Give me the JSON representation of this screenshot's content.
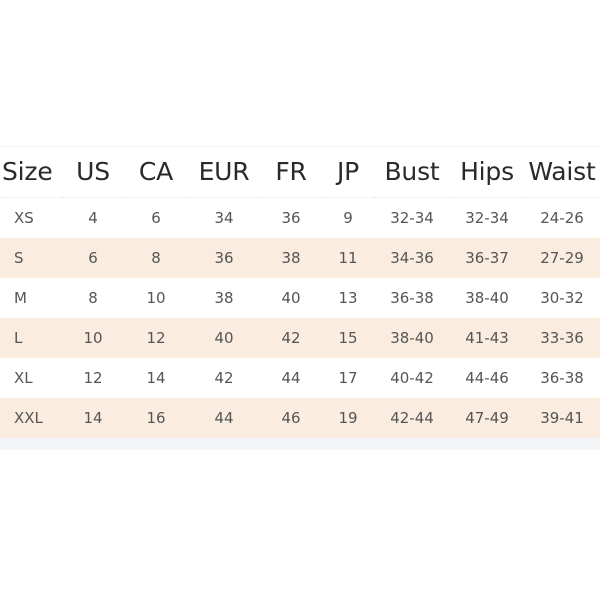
{
  "chart_data": {
    "type": "table",
    "title": "",
    "columns": [
      "Size",
      "US",
      "CA",
      "EUR",
      "FR",
      "JP",
      "Bust",
      "Hips",
      "Waist"
    ],
    "rows": [
      [
        "XS",
        "4",
        "6",
        "34",
        "36",
        "9",
        "32-34",
        "32-34",
        "24-26"
      ],
      [
        "S",
        "6",
        "8",
        "36",
        "38",
        "11",
        "34-36",
        "36-37",
        "27-29"
      ],
      [
        "M",
        "8",
        "10",
        "38",
        "40",
        "13",
        "36-38",
        "38-40",
        "30-32"
      ],
      [
        "L",
        "10",
        "12",
        "40",
        "42",
        "15",
        "38-40",
        "41-43",
        "33-36"
      ],
      [
        "XL",
        "12",
        "14",
        "42",
        "44",
        "17",
        "40-42",
        "44-46",
        "36-38"
      ],
      [
        "XXL",
        "14",
        "16",
        "44",
        "46",
        "19",
        "42-44",
        "47-49",
        "39-41"
      ]
    ]
  },
  "colors": {
    "page_background": "#ffffff",
    "row_alt_background": "#faede0",
    "row_base_background": "#ffffff",
    "header_text": "#2a2a2a",
    "body_text": "#555555",
    "header_rule": "#e6e7e9",
    "footer_strip": "#f4f5f6"
  }
}
